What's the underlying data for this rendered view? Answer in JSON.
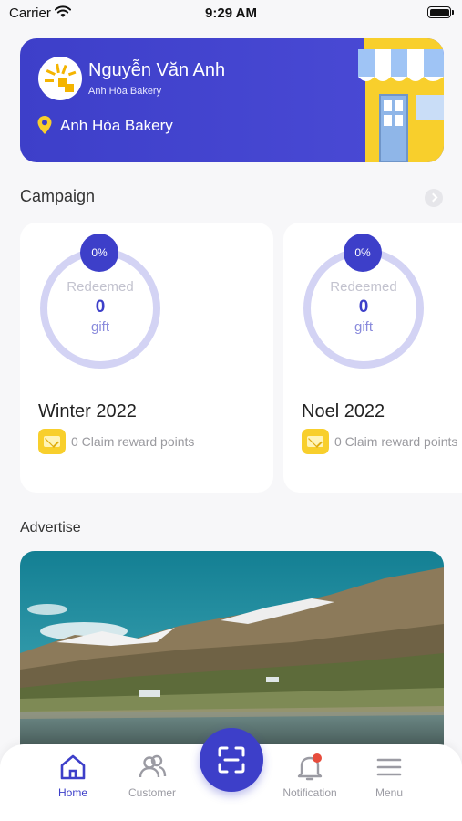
{
  "status_bar": {
    "carrier": "Carrier",
    "time": "9:29 AM"
  },
  "store_card": {
    "owner_name": "Nguyễn Văn Anh",
    "store_name": "Anh Hòa Bakery",
    "location": "Anh Hòa Bakery"
  },
  "campaign_section": {
    "title": "Campaign",
    "campaigns": [
      {
        "percent": "0%",
        "redeemed_label": "Redeemed",
        "count": "0",
        "unit": "gift",
        "name": "Winter 2022",
        "reward_text": "0 Claim reward points"
      },
      {
        "percent": "0%",
        "redeemed_label": "Redeemed",
        "count": "0",
        "unit": "gift",
        "name": "Noel 2022",
        "reward_text": "0 Claim reward points"
      }
    ]
  },
  "advertise_section": {
    "title": "Advertise"
  },
  "bottom_nav": {
    "items": [
      {
        "label": "Home",
        "icon": "home-icon",
        "active": true
      },
      {
        "label": "Customer",
        "icon": "customer-icon",
        "active": false
      },
      {
        "label": "Notification",
        "icon": "bell-icon",
        "active": false
      },
      {
        "label": "Menu",
        "icon": "menu-icon",
        "active": false
      }
    ],
    "scan_icon": "scan-icon"
  },
  "colors": {
    "primary": "#3d3fc9",
    "ring": "#d3d3f4",
    "reward": "#f8cf2c",
    "badge": "#e74c3c"
  }
}
